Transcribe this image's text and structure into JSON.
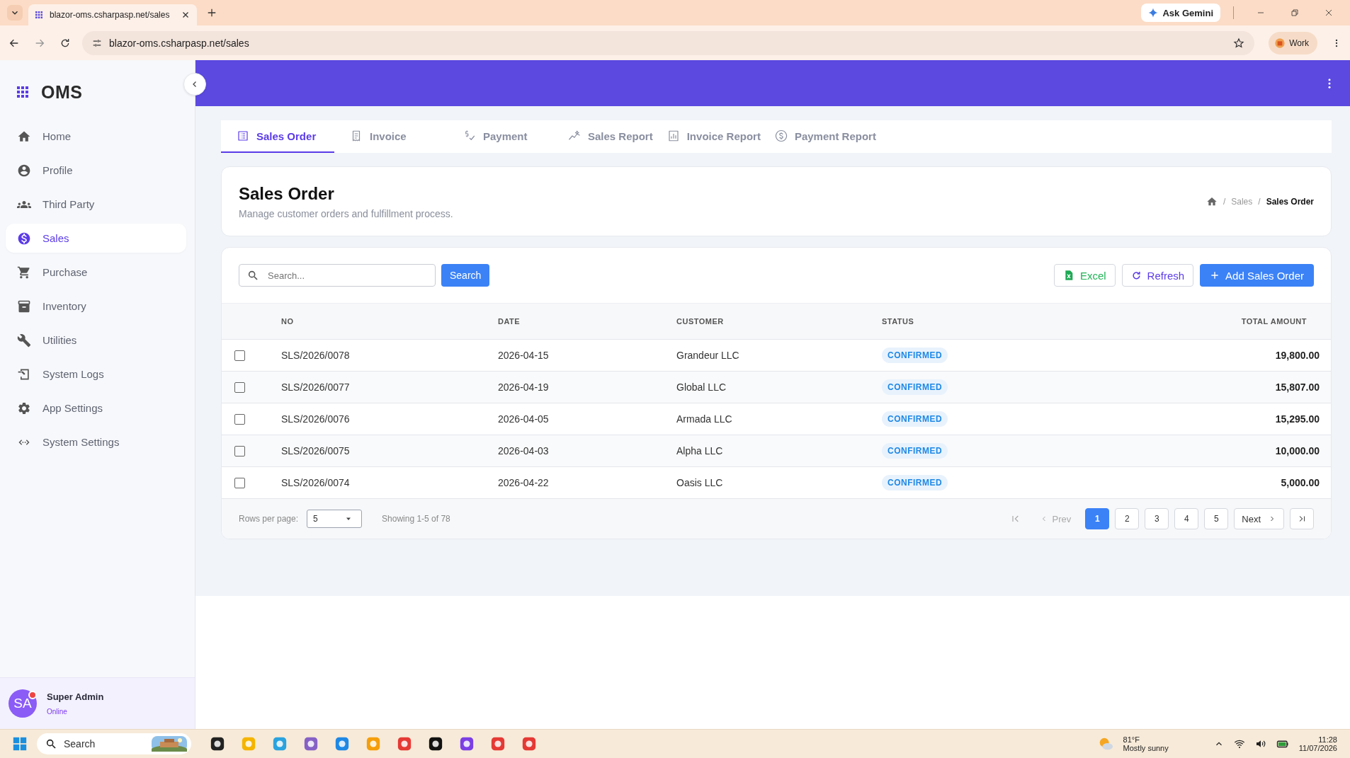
{
  "browser": {
    "tab_title": "blazor-oms.csharpasp.net/sales",
    "url": "blazor-oms.csharpasp.net/sales",
    "ask_button": "Ask Gemini",
    "profile": "Work"
  },
  "sidebar": {
    "logo": "OMS",
    "items": [
      {
        "label": "Home",
        "selected": false
      },
      {
        "label": "Profile",
        "selected": false
      },
      {
        "label": "Third Party",
        "selected": false
      },
      {
        "label": "Sales",
        "selected": true
      },
      {
        "label": "Purchase",
        "selected": false
      },
      {
        "label": "Inventory",
        "selected": false
      },
      {
        "label": "Utilities",
        "selected": false
      },
      {
        "label": "System Logs",
        "selected": false
      },
      {
        "label": "App Settings",
        "selected": false
      },
      {
        "label": "System Settings",
        "selected": false
      }
    ],
    "user": {
      "initials": "SA",
      "name": "Super Admin",
      "status": "Online"
    }
  },
  "tabs": [
    {
      "label": "Sales Order",
      "selected": true
    },
    {
      "label": "Invoice",
      "selected": false
    },
    {
      "label": "Payment",
      "selected": false
    },
    {
      "label": "Sales Report",
      "selected": false
    },
    {
      "label": "Invoice Report",
      "selected": false
    },
    {
      "label": "Payment Report",
      "selected": false
    }
  ],
  "page": {
    "title": "Sales Order",
    "subtitle": "Manage customer orders and fulfillment process.",
    "breadcrumb_separator": "/",
    "breadcrumb": [
      "Sales",
      "Sales Order"
    ]
  },
  "toolbar": {
    "search_placeholder": "Search...",
    "search_button": "Search",
    "buttons": [
      {
        "label": "Excel",
        "kind": "excel"
      },
      {
        "label": "Refresh",
        "kind": "refresh"
      },
      {
        "label": "Add Sales Order",
        "kind": "add"
      }
    ]
  },
  "table": {
    "columns": [
      "NO",
      "DATE",
      "CUSTOMER",
      "STATUS",
      "TOTAL AMOUNT"
    ],
    "rows": [
      {
        "checked": false,
        "no": "SLS/2026/0078",
        "date": "2026-04-15",
        "customer": "Grandeur LLC",
        "status": "CONFIRMED",
        "total": "19,800.00"
      },
      {
        "checked": false,
        "no": "SLS/2026/0077",
        "date": "2026-04-19",
        "customer": "Global LLC",
        "status": "CONFIRMED",
        "total": "15,807.00"
      },
      {
        "checked": false,
        "no": "SLS/2026/0076",
        "date": "2026-04-05",
        "customer": "Armada LLC",
        "status": "CONFIRMED",
        "total": "15,295.00"
      },
      {
        "checked": false,
        "no": "SLS/2026/0075",
        "date": "2026-04-03",
        "customer": "Alpha LLC",
        "status": "CONFIRMED",
        "total": "10,000.00"
      },
      {
        "checked": false,
        "no": "SLS/2026/0074",
        "date": "2026-04-22",
        "customer": "Oasis LLC",
        "status": "CONFIRMED",
        "total": "5,000.00"
      }
    ]
  },
  "pagination": {
    "rows_label": "Rows per page:",
    "rows_value": "5",
    "showing": "Showing 1-5 of 78",
    "prev": "Prev",
    "next": "Next",
    "pages": [
      {
        "label": "1",
        "selected": true
      },
      {
        "label": "2",
        "selected": false
      },
      {
        "label": "3",
        "selected": false
      },
      {
        "label": "4",
        "selected": false
      },
      {
        "label": "5",
        "selected": false
      }
    ]
  },
  "taskbar": {
    "search": "Search",
    "temperature": "81°F",
    "weather": "Mostly sunny",
    "time": "11:28",
    "date": "11/07/2026"
  }
}
